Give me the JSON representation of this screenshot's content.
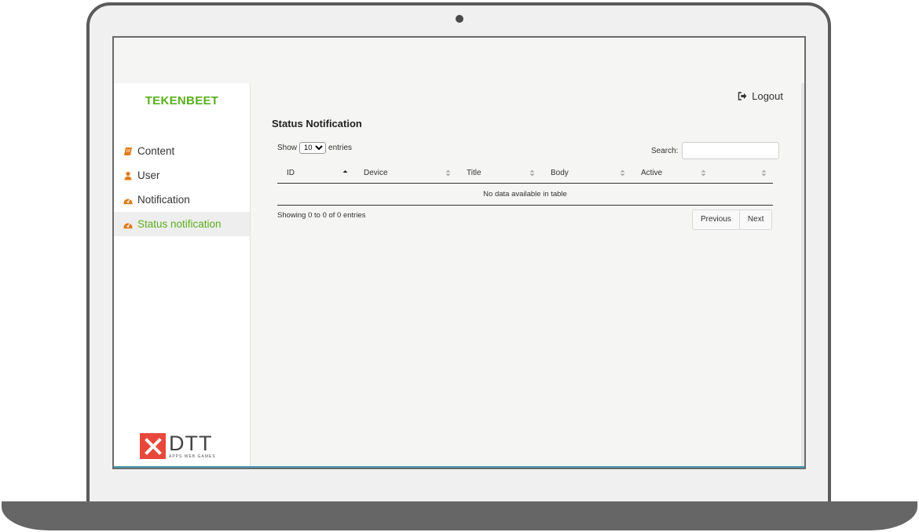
{
  "app": {
    "brand": "TEKENBEET"
  },
  "sidebar": {
    "items": [
      {
        "label": "Content",
        "icon": "book-icon"
      },
      {
        "label": "User",
        "icon": "user-icon"
      },
      {
        "label": "Notification",
        "icon": "dashboard-icon"
      },
      {
        "label": "Status notification",
        "icon": "dashboard-icon",
        "active": true
      }
    ],
    "footer_logo": {
      "name": "DTT",
      "tagline": "APPS WEB GAMES"
    }
  },
  "header": {
    "logout_label": "Logout"
  },
  "main": {
    "title": "Status Notification",
    "length": {
      "prefix": "Show",
      "value": "10",
      "suffix": "entries"
    },
    "search": {
      "label": "Search:",
      "value": ""
    },
    "table": {
      "columns": [
        "ID",
        "Device",
        "Title",
        "Body",
        "Active",
        ""
      ],
      "empty_message": "No data available in table"
    },
    "info": "Showing 0 to 0 of 0 entries",
    "pagination": {
      "previous": "Previous",
      "next": "Next"
    }
  },
  "colors": {
    "accent": "#5aaf1e",
    "icon_orange": "#e07b1a",
    "logo_red": "#e8473b"
  }
}
